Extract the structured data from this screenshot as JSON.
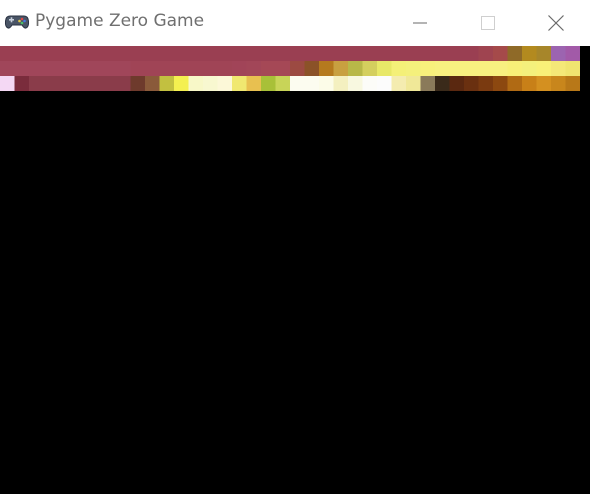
{
  "window": {
    "title": "Pygame Zero Game",
    "app_icon": "gamepad-icon",
    "controls": {
      "minimize": "minimize-icon",
      "maximize": "maximize-icon",
      "close": "close-icon"
    }
  },
  "colors": {
    "titlebar_bg": "#ffffff",
    "title_text": "#6f6f6f",
    "game_bg": "#000000",
    "row1": [
      "#9a3f52",
      "#9a3f52",
      "#9a3f52",
      "#9a3f52",
      "#9a3f52",
      "#9a3f52",
      "#9a3f52",
      "#9a3f52",
      "#9a3f52",
      "#9a3f52",
      "#9a3f52",
      "#9a3f52",
      "#9a3f52",
      "#9a3f52",
      "#9a3f52",
      "#9a3f52",
      "#9a3f52",
      "#9a3f52",
      "#9a3f52",
      "#9a3f52",
      "#9a3f52",
      "#9a3f52",
      "#9a3f52",
      "#9a3f52",
      "#9a3f52",
      "#9a3f52",
      "#9a3f52",
      "#9a3f52",
      "#9a3f52",
      "#9a3f52",
      "#9a3f52",
      "#9a3f52",
      "#9a3f52",
      "#9f4450",
      "#a54a4a",
      "#8f6a28",
      "#b38a1f",
      "#a7862a",
      "#9c64b0",
      "#a25aa8"
    ],
    "row2": [
      "#a0465a",
      "#a0465a",
      "#a0465a",
      "#a0465a",
      "#a0465a",
      "#a0465a",
      "#a0465a",
      "#a0465a",
      "#a0465a",
      "#a04456",
      "#a04456",
      "#a04456",
      "#a04456",
      "#a04456",
      "#a04456",
      "#a04456",
      "#a14458",
      "#a24658",
      "#a54856",
      "#a54856",
      "#9c4a42",
      "#8b5228",
      "#b57a1e",
      "#c8a040",
      "#b8b848",
      "#d4cf5e",
      "#e8e868",
      "#f4f078",
      "#f4f07c",
      "#f8f07c",
      "#f8f080",
      "#f8f080",
      "#f8f080",
      "#f8f080",
      "#f8f080",
      "#f8f078",
      "#f4f07c",
      "#f8f078",
      "#f4e878",
      "#f0e470"
    ],
    "row3": [
      "#f4d8f4",
      "#7a2c3c",
      "#8a3c4a",
      "#8a3c4a",
      "#8a3c4a",
      "#8a3c4a",
      "#8a3c4a",
      "#8a3c4a",
      "#8a3c4a",
      "#6e3a2c",
      "#8a5a3a",
      "#c2c040",
      "#f4f050",
      "#f8f8c8",
      "#f8f8d0",
      "#fcf8d8",
      "#f0e870",
      "#e8c050",
      "#a8c038",
      "#c8d458",
      "#fcfcf0",
      "#fcfcf0",
      "#fcfce8",
      "#f4f0c0",
      "#f8f8e0",
      "#fcfcf8",
      "#fcfcfc",
      "#f4ecb0",
      "#f0e898",
      "#8a7a5a",
      "#3a2a1a",
      "#5a2810",
      "#6a3010",
      "#7a3a10",
      "#8c4810",
      "#b06a14",
      "#c88018",
      "#d49020",
      "#c8861c",
      "#b87818"
    ]
  }
}
